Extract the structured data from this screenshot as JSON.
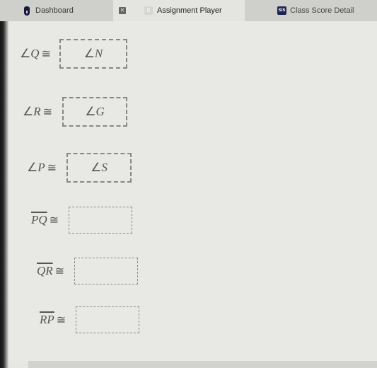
{
  "tabs": {
    "dashboard": {
      "label": "Dashboard",
      "icon": "brand-b-icon"
    },
    "assignment": {
      "label": "Assignment Player",
      "icon": "b-favicon",
      "favicon_letter": "B",
      "close_glyph": "✕",
      "active": true
    },
    "sis": {
      "label": "Class Score Detail",
      "icon": "sis-icon",
      "badge": "SIS"
    }
  },
  "congruence_symbol": "≅",
  "angle_symbol": "∠",
  "statements": [
    {
      "kind": "angle",
      "left": "Q",
      "answer": "N"
    },
    {
      "kind": "angle",
      "left": "R",
      "answer": "G"
    },
    {
      "kind": "angle",
      "left": "P",
      "answer": "S"
    },
    {
      "kind": "segment",
      "left": "PQ",
      "answer": ""
    },
    {
      "kind": "segment",
      "left": "QR",
      "answer": ""
    },
    {
      "kind": "segment",
      "left": "RP",
      "answer": ""
    }
  ]
}
